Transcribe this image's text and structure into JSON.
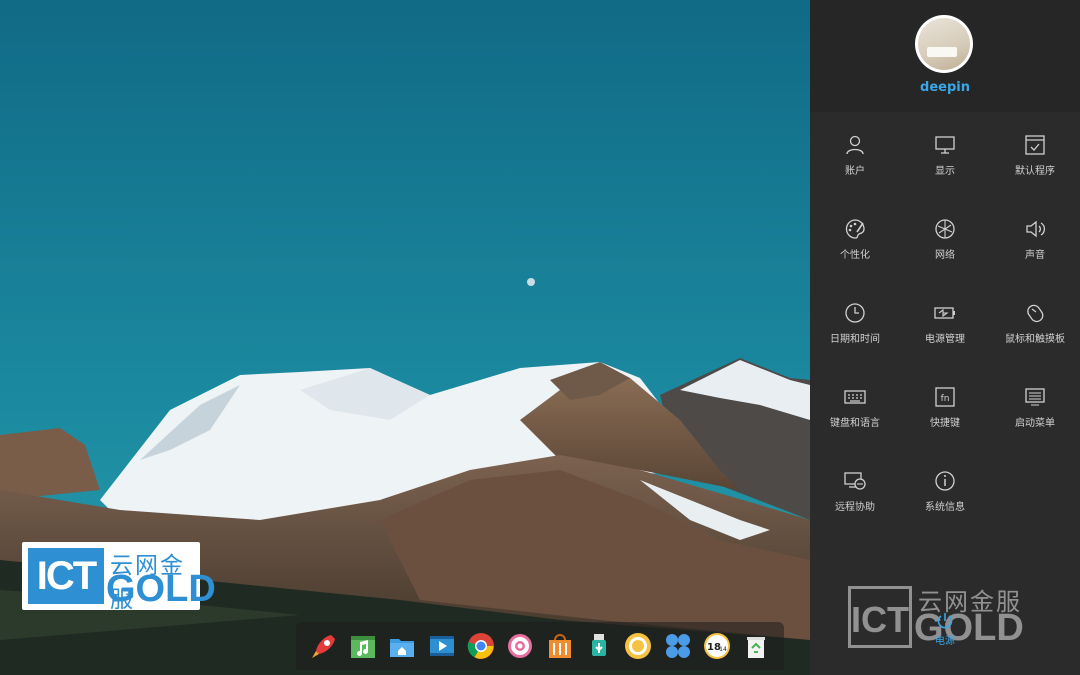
{
  "desktop": {
    "watermark": {
      "ict": "ICT",
      "chinese": "云网金服",
      "english": "GOLD"
    }
  },
  "dock": {
    "apps": [
      "launcher",
      "deepin-music",
      "file-manager",
      "deepin-movie",
      "google-chrome",
      "control-center",
      "app-store",
      "usb-device",
      "deepin-screenshot",
      "multitasking-view",
      "calendar",
      "trash"
    ],
    "calendar_text": "18",
    "calendar_day": "14"
  },
  "panel": {
    "username": "deepin",
    "items": [
      {
        "label": "账户",
        "icon": "user-icon"
      },
      {
        "label": "显示",
        "icon": "monitor-icon"
      },
      {
        "label": "默认程序",
        "icon": "default-apps-icon"
      },
      {
        "label": "个性化",
        "icon": "palette-icon"
      },
      {
        "label": "网络",
        "icon": "network-icon"
      },
      {
        "label": "声音",
        "icon": "speaker-icon"
      },
      {
        "label": "日期和时间",
        "icon": "clock-icon"
      },
      {
        "label": "电源管理",
        "icon": "battery-icon"
      },
      {
        "label": "鼠标和触摸板",
        "icon": "mouse-icon"
      },
      {
        "label": "键盘和语言",
        "icon": "keyboard-icon"
      },
      {
        "label": "快捷键",
        "icon": "fn-key-icon"
      },
      {
        "label": "启动菜单",
        "icon": "boot-menu-icon"
      },
      {
        "label": "远程协助",
        "icon": "remote-icon"
      },
      {
        "label": "系统信息",
        "icon": "info-icon"
      }
    ],
    "power_label": "电源",
    "watermark": {
      "ict": "ICT",
      "chinese": "云网金服",
      "english": "GOLD"
    }
  },
  "colors": {
    "accent": "#3aa7e8",
    "panel_bg": "#2b2b2b",
    "sky": "#1a7f95"
  }
}
